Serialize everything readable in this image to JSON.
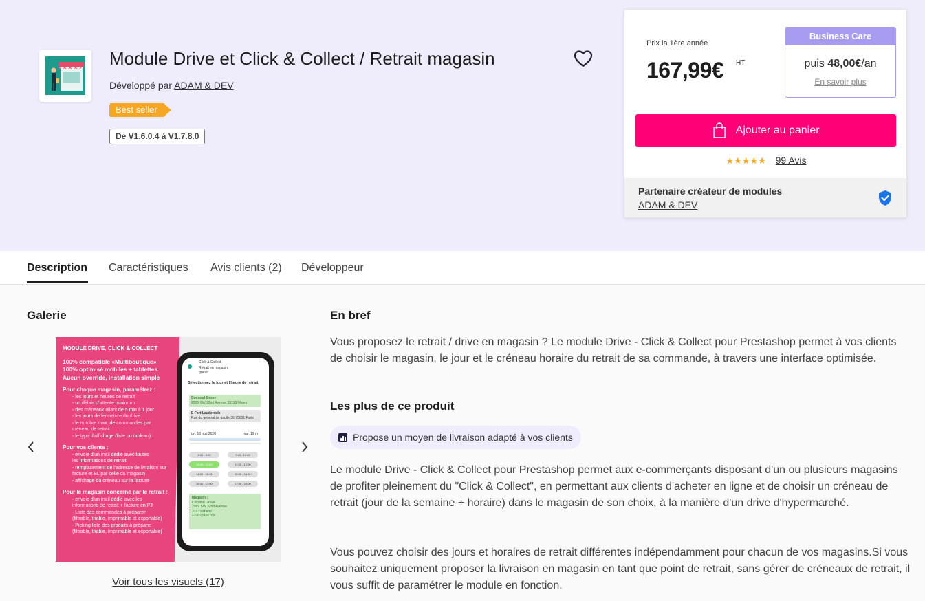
{
  "product": {
    "title": "Module Drive et Click & Collect / Retrait magasin",
    "developed_by_label": "Développé par",
    "developer": "ADAM & DEV",
    "best_seller": "Best seller",
    "version_range": "De V1.6.0.4 à V1.7.8.0",
    "icons": {
      "favorite": "heart-icon",
      "logo": "store-icon"
    }
  },
  "pricing": {
    "first_year_label": "Prix la 1ère année",
    "price": "167,99€",
    "tax_label": "HT",
    "business_care": {
      "title": "Business Care",
      "then_prefix": "puis",
      "then_amount": "48,00€",
      "then_suffix": "/an",
      "learn_more": "En savoir plus"
    },
    "add_to_cart": "Ajouter au panier",
    "stars": "★★★★★",
    "rating": 5,
    "reviews_link": "99 Avis",
    "partner_title": "Partenaire créateur de modules",
    "partner_name": "ADAM & DEV",
    "colors": {
      "accent": "#ff0077",
      "business_care": "#a79cf0",
      "star": "#f5a623",
      "verified": "#1a73e8"
    }
  },
  "tabs": [
    {
      "label": "Description",
      "active": true
    },
    {
      "label": "Caractéristiques",
      "active": false
    },
    {
      "label": "Avis clients (2)",
      "active": false
    },
    {
      "label": "Développeur",
      "active": false
    }
  ],
  "gallery": {
    "title": "Galerie",
    "see_all": "Voir tous les visuels (17)",
    "image": {
      "heading": "MODULE DRIVE, CLICK & COLLECT",
      "bold_lines": [
        "100% compatible «Multiboutique»",
        "100% optimisé mobiles + tablettes",
        "Aucun override, installation simple"
      ],
      "section1_title": "Pour chaque magasin, paramétrez :",
      "section1_items": [
        "- les jours et heures de retrait",
        "- un délais d'attente minimum",
        "- des créneaux allant de 5 min à 1 jour",
        "- les jours de fermeture du drive",
        "- le nombre max. de commandes par",
        "  créneau de retrait",
        "- le type d'affichage (liste ou tableau)"
      ],
      "section2_title": "Pour vos clients :",
      "section2_items": [
        "- envoie d'un mail dédié avec toutes",
        "  les informations de retrait",
        "- remplacement de l'adresse de livraison sur",
        "  facture et BL par celle du magasin",
        "- affichage du créneau sur la facture"
      ],
      "section3_title": "Pour le magasin concerné par le retrait :",
      "section3_items": [
        "- envoie d'un mail dédié avec les",
        "  informations de retrait + facture en PJ",
        "- Liste des commandes à préparer",
        "  (filtrable, triable, imprimable et exportable)",
        "- Picking liste des produits à préparer",
        "  (filtrable, triable, imprimable et exportable)"
      ],
      "phone": {
        "header_title": "Click & Collect",
        "header_sub": "Retrait en magasin",
        "header_sub2": "gratuit",
        "select_label": "Sélectionnez le jour et l'heure de retrait",
        "store1_name": "Coconut Grove",
        "store1_addr": "2999 SW 32nd Avenue 33133 Miami",
        "store2_name": "E Fort Lauderdale",
        "store2_addr": "Rue du général de gaulle 36 75001 Paris",
        "date_left": "lun. 18 mai 2020",
        "date_right": "mar. 19 m",
        "slots": [
          "8:00 - 9:00",
          "9:00 - 10:00",
          "10:00 - 11:00",
          "11:00 - 12:00",
          "14:00 - 15:00",
          "15:00 - 16:00",
          "16:00 - 17:00",
          "17:00 - 18:00"
        ],
        "store_box_title": "Magasin :",
        "store_box_lines": [
          "Coconut Grove",
          "2999 SW 32nd Avenue",
          "33133 Miami",
          "+33023456789"
        ]
      }
    }
  },
  "description": {
    "brief_title": "En bref",
    "brief_text": "Vous proposez le retrait / drive en magasin ?  Le module Drive - Click & Collect pour Prestashop permet à vos clients de choisir le magasin, le jour et le créneau horaire du retrait de sa commande, à travers une interface optimisée.",
    "plus_title": "Les plus de ce produit",
    "plus_pill": "Propose un moyen de livraison adapté à vos clients",
    "para2": "Le module Drive - Click & Collect pour Prestashop permet aux e-commerçants disposant d'un ou plusieurs magasins de profiter pleinement du \"Click & Collect\", en permettant aux clients d'acheter en ligne et de choisir un créneau de retrait (jour de la semaine + horaire) dans le magasin de son choix, à la manière d'un drive d'hypermarché.",
    "para3": "Vous pouvez choisir des jours et horaires de retrait différentes indépendamment pour chacun de vos magasins.Si vous souhaitez uniquement proposer la livraison en magasin en tant que point de retrait, sans gérer de créneaux de retrait, il vous suffit de paramétrer le module en fonction."
  }
}
